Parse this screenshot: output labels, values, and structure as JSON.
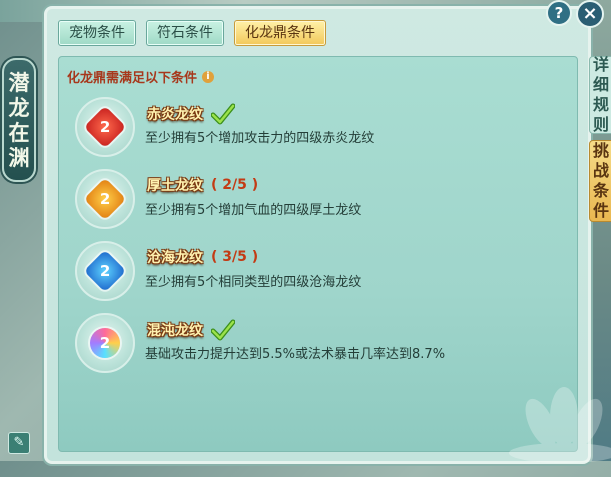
{
  "left_title": [
    "潜",
    "龙",
    "在",
    "渊"
  ],
  "tabs": [
    {
      "label": "宠物条件",
      "active": false
    },
    {
      "label": "符石条件",
      "active": false
    },
    {
      "label": "化龙鼎条件",
      "active": true
    }
  ],
  "header": {
    "title": "化龙鼎需满足以下条件",
    "info_icon": "i"
  },
  "items": [
    {
      "name": "赤炎龙纹",
      "progress": "",
      "completed": true,
      "desc": "至少拥有5个增加攻击力的四级赤炎龙纹",
      "gem": "red"
    },
    {
      "name": "厚土龙纹",
      "progress": "( 2/5 )",
      "completed": false,
      "desc": "至少拥有5个增加气血的四级厚土龙纹",
      "gem": "orange"
    },
    {
      "name": "沧海龙纹",
      "progress": "( 3/5 )",
      "completed": false,
      "desc": "至少拥有5个相同类型的四级沧海龙纹",
      "gem": "blue"
    },
    {
      "name": "混沌龙纹",
      "progress": "",
      "completed": true,
      "desc": "基础攻击力提升达到5.5%或法术暴击几率达到8.7%",
      "gem": "multi"
    }
  ],
  "side_tabs": {
    "rules": [
      "详",
      "细",
      "规",
      "则"
    ],
    "challenge": [
      "挑",
      "战",
      "条",
      "件"
    ]
  },
  "buttons": {
    "help": "?",
    "close": "×"
  },
  "colors": {
    "accent": "#f2c85a",
    "header_text": "#a7381c",
    "progress_text": "#c33b14"
  }
}
